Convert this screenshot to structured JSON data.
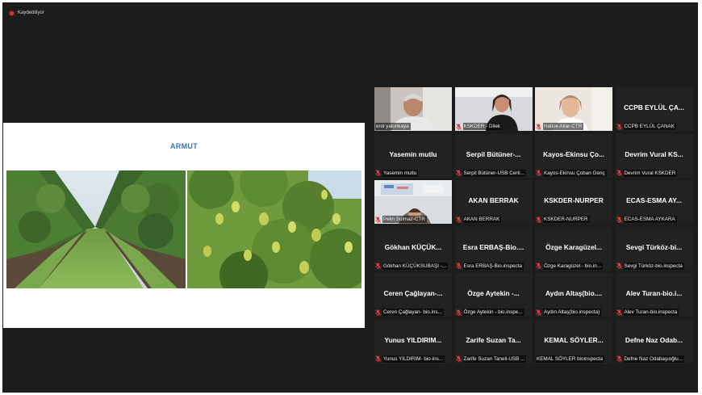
{
  "recording": {
    "label": "Kaydediliyor"
  },
  "share": {
    "title": "ARMUT"
  },
  "gallery": {
    "tiles": [
      {
        "big": "",
        "label": "erol yalonkaya",
        "video": "man",
        "active": true,
        "muted": false
      },
      {
        "big": "",
        "label": "KSKDER - Dilek",
        "video": "woman-dark",
        "active": false,
        "muted": true
      },
      {
        "big": "",
        "label": "Hatice Akar-CTR",
        "video": "woman-light",
        "active": false,
        "muted": true
      },
      {
        "big": "CCPB EYLÜL ÇA...",
        "label": "CCPB EYLÜL ÇANAK",
        "video": "",
        "active": false,
        "muted": true
      },
      {
        "big": "Yasemin mutlu",
        "label": "Yasemin mutlu",
        "video": "",
        "active": false,
        "muted": true
      },
      {
        "big": "Serpil Bütüner-...",
        "label": "Serpil Bütüner-USB Certi...",
        "video": "",
        "active": false,
        "muted": true
      },
      {
        "big": "Kayos-Ekinsu Ço...",
        "label": "Kayos-Ekinsu Çoban Genç",
        "video": "",
        "active": false,
        "muted": true
      },
      {
        "big": "Devrim Vural KS...",
        "label": "Devrim Vural KSKDER",
        "video": "",
        "active": false,
        "muted": true
      },
      {
        "big": "",
        "label": "Pelin Sulmaz-CTR",
        "video": "room",
        "active": false,
        "muted": true
      },
      {
        "big": "AKAN BERRAK",
        "label": "AKAN BERRAK",
        "video": "",
        "active": false,
        "muted": true
      },
      {
        "big": "KSKDER-NURPER",
        "label": "KSKDER-NURPER",
        "video": "",
        "active": false,
        "muted": true
      },
      {
        "big": "ECAS-ESMA AY...",
        "label": "ECAS-ESMA AYKARA",
        "video": "",
        "active": false,
        "muted": true
      },
      {
        "big": "Gökhan KÜÇÜK...",
        "label": "Gökhan KÜÇÜKSUBAŞI -...",
        "video": "",
        "active": false,
        "muted": true
      },
      {
        "big": "Esra ERBAŞ-Bio....",
        "label": "Esra ERBAŞ-Bio.inspecta",
        "video": "",
        "active": false,
        "muted": true
      },
      {
        "big": "Özge Karagüzel...",
        "label": "Özge Karagüzel - bio.in...",
        "video": "",
        "active": false,
        "muted": true
      },
      {
        "big": "Sevgi Türköz-bi...",
        "label": "Sevgi Türköz-bio.inspecta",
        "video": "",
        "active": false,
        "muted": true
      },
      {
        "big": "Ceren Çağlayan-...",
        "label": "Ceren Çağlayan- bio.ins...",
        "video": "",
        "active": false,
        "muted": true
      },
      {
        "big": "Özge Aytekin -...",
        "label": "Özge Aytekin - bio.inspe...",
        "video": "",
        "active": false,
        "muted": true
      },
      {
        "big": "Aydın Altaş(bio....",
        "label": "Aydın Altaş(bio.inspecta)",
        "video": "",
        "active": false,
        "muted": true
      },
      {
        "big": "Alev Turan-bio.i...",
        "label": "Alev Turan-bio.inspecta",
        "video": "",
        "active": false,
        "muted": true
      },
      {
        "big": "Yunus YILDIRIM...",
        "label": "Yunus YILDIRIM- bio-ins...",
        "video": "",
        "active": false,
        "muted": true
      },
      {
        "big": "Zarife Suzan Ta...",
        "label": "Zarife Suzan Taneli-USB ...",
        "video": "",
        "active": false,
        "muted": true
      },
      {
        "big": "KEMAL SÖYLER...",
        "label": "KEMAL SÖYLER bioinspecta",
        "video": "",
        "active": false,
        "muted": false
      },
      {
        "big": "Defne Naz Odab...",
        "label": "Defne Naz Odabaşıoğlu...",
        "video": "",
        "active": false,
        "muted": true
      }
    ]
  },
  "colors": {
    "accent_active": "#a6d66a",
    "muted_icon": "#e03b3b",
    "title_blue": "#2e75b6"
  }
}
